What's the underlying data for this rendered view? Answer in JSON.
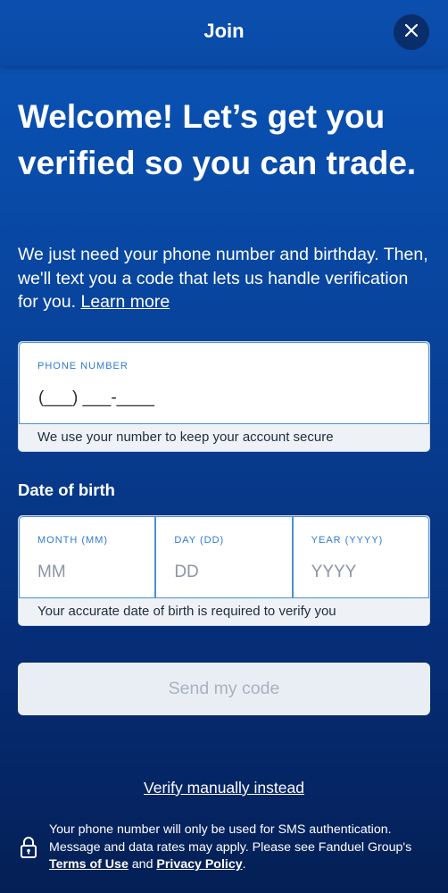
{
  "header": {
    "title": "Join",
    "close_icon": "close-icon"
  },
  "main": {
    "headline": "Welcome! Let’s get you verified so you can trade.",
    "intro_text": "We just need your phone number and birthday. Then, we'll text you a code that lets us handle verification for you.",
    "learn_more": "Learn more"
  },
  "phone": {
    "label": "PHONE NUMBER",
    "value": "(___) ___-____",
    "note": "We use your number to keep your account secure"
  },
  "dob": {
    "title": "Date of birth",
    "month_label": "MONTH (MM)",
    "month_placeholder": "MM",
    "day_label": "DAY (DD)",
    "day_placeholder": "DD",
    "year_label": "YEAR (YYYY)",
    "year_placeholder": "YYYY",
    "note": "Your accurate date of birth is required to verify you"
  },
  "actions": {
    "send_code": "Send my code",
    "verify_manually": "Verify manually instead"
  },
  "footer": {
    "lock_icon": "lock-icon",
    "text_1": "Your phone number will only be used for SMS authentication. Message and data rates may apply. Please see Fanduel Group's ",
    "terms": "Terms of Use",
    "and": " and ",
    "privacy": "Privacy Policy",
    "end": "."
  },
  "colors": {
    "accent": "#2f7bd3",
    "background_top": "#0a55b8",
    "background_bottom": "#041f55"
  }
}
